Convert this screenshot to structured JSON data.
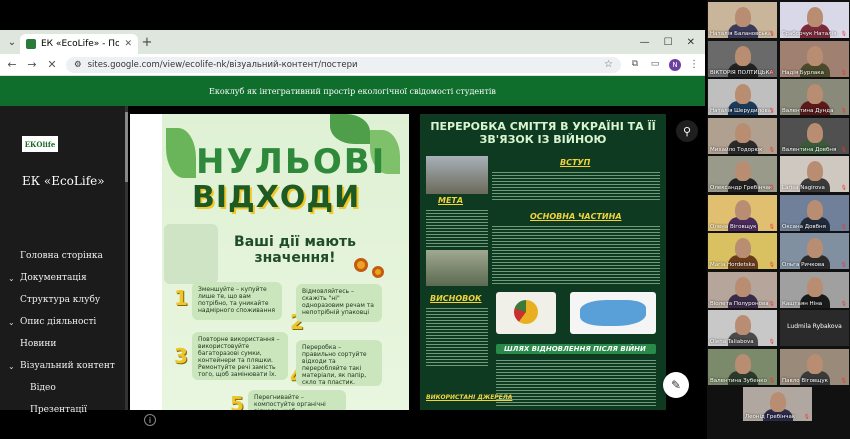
{
  "browser": {
    "tab_title": "ЕК «EcoLife» - Постери",
    "url": "sites.google.com/view/ecolife-nk/візуальний-контент/постери",
    "profile_initial": "N"
  },
  "site": {
    "header_text": "Екоклуб як інтегративний простір екологічної свідомості студентів",
    "logo_text": "ЕКОlife",
    "title": "ЕК «EcoLife»",
    "nav": [
      {
        "label": "Головна сторінка"
      },
      {
        "label": "Документація"
      },
      {
        "label": "Структура клубу"
      },
      {
        "label": "Опис діяльності"
      },
      {
        "label": "Новини"
      },
      {
        "label": "Візуальний контент"
      },
      {
        "label": "Відео"
      },
      {
        "label": "Презентації"
      }
    ]
  },
  "poster1": {
    "title_line1": "НУЛЬОВІ",
    "title_line2": "ВІДХОДИ",
    "subtitle": "Ваші дії мають значення!",
    "items": [
      {
        "num": "1",
        "text": "Зменшуйте – купуйте лише те, що вам потрібно, та уникайте надмірного споживання"
      },
      {
        "num": "2",
        "text": "Відмовляйтесь – скажіть \"ні\" одноразовим речам та непотрібній упаковці"
      },
      {
        "num": "3",
        "text": "Повторне використання – використовуйте багаторазові сумки, контейнери та пляшки. Ремонтуйте речі замість того, щоб замінювати їх."
      },
      {
        "num": "4",
        "text": "Переробка – правильно сортуйте відходи та переробляйте такі матеріали, як папір, скло та пластик."
      },
      {
        "num": "5",
        "text": "Перегнивайте – компостуйте органічні відходи, щоб"
      }
    ]
  },
  "poster2": {
    "title": "ПЕРЕРОБКА СМІТТЯ В УКРАЇНІ ТА ЇЇ ЗВ'ЯЗОК ІЗ ВІЙНОЮ",
    "sections": {
      "intro": "ВСТУП",
      "goal": "МЕТА",
      "main": "ОСНОВНА ЧАСТИНА",
      "conclusions": "ВИСНОВОК",
      "postwar": "ШЛЯХ ВІДНОВЛЕННЯ ПІСЛЯ ВІЙНИ",
      "sources": "ВИКОРИСТАНІ ДЖЕРЕЛА"
    }
  },
  "participants": [
    {
      "name": "Наталія Балановська"
    },
    {
      "name": "Граборчук Наталія"
    },
    {
      "name": "ВІКТОРІЯ ПОЛТИЦЬКА"
    },
    {
      "name": "Надія Бурлака"
    },
    {
      "name": "Наталія Шерудилова"
    },
    {
      "name": "Валентина Дунда"
    },
    {
      "name": "Михайло Тодорюк"
    },
    {
      "name": "Валентина Довбня"
    },
    {
      "name": "Олександр Гребінчак"
    },
    {
      "name": "Larisa Nagirova"
    },
    {
      "name": "Олена Віговщук"
    },
    {
      "name": "Оксана Довбня"
    },
    {
      "name": "Maria Hordetska"
    },
    {
      "name": "Ольга Ричкова"
    },
    {
      "name": "Віолета Полуронова"
    },
    {
      "name": "Каштаян Ніна"
    },
    {
      "name": "Olena Taliabova"
    },
    {
      "name": "Ludmila Rybakova"
    },
    {
      "name": "Валентина Зубенко"
    },
    {
      "name": "Павло Віговщук"
    },
    {
      "name": "Леонід Гребінчак"
    }
  ],
  "colors": {
    "site_green": "#0f6e2c",
    "sidebar": "#1b1b1b",
    "poster2_bg": "#0f3a22",
    "accent_yellow": "#f3d33a"
  }
}
